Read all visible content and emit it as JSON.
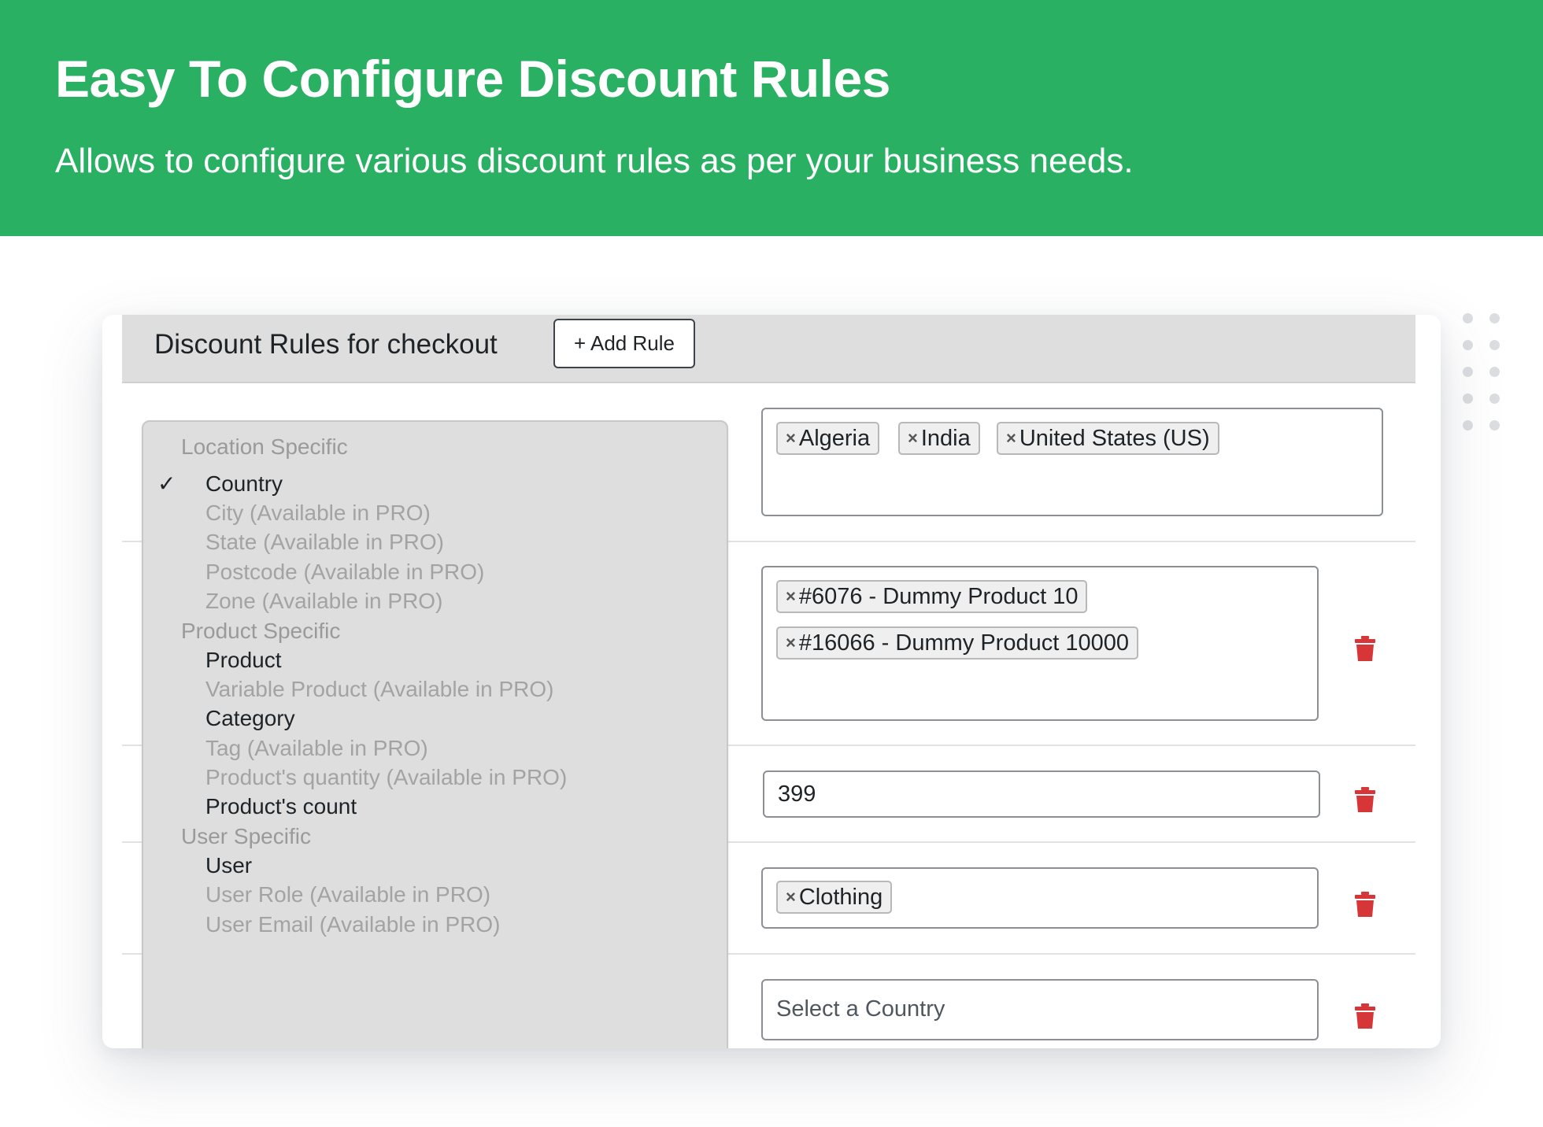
{
  "banner": {
    "title": "Easy To Configure Discount Rules",
    "subtitle": "Allows to configure various discount rules as per your business needs.",
    "color": "#2ab063"
  },
  "panel": {
    "title": "Discount Rules for checkout",
    "add_rule_label": "+ Add Rule"
  },
  "dropdown": {
    "groups": [
      {
        "label": "Location Specific",
        "items": [
          {
            "label": "Country",
            "checked": true,
            "disabled": false
          },
          {
            "label": "City (Available in PRO)",
            "disabled": true
          },
          {
            "label": "State (Available in PRO)",
            "disabled": true
          },
          {
            "label": "Postcode (Available in PRO)",
            "disabled": true
          },
          {
            "label": "Zone (Available in PRO)",
            "disabled": true
          }
        ]
      },
      {
        "label": "Product Specific",
        "items": [
          {
            "label": "Product",
            "disabled": false
          },
          {
            "label": "Variable Product (Available in PRO)",
            "disabled": true
          },
          {
            "label": "Category",
            "disabled": false
          },
          {
            "label": "Tag (Available in PRO)",
            "disabled": true
          },
          {
            "label": "Product's quantity (Available in PRO)",
            "disabled": true
          },
          {
            "label": "Product's count",
            "disabled": false
          }
        ]
      },
      {
        "label": "User Specific",
        "items": [
          {
            "label": "User",
            "disabled": false
          },
          {
            "label": "User Role (Available in PRO)",
            "disabled": true
          },
          {
            "label": "User Email (Available in PRO)",
            "disabled": true
          }
        ]
      }
    ],
    "check_glyph": "✓"
  },
  "rules": {
    "countries": {
      "tags": [
        "Algeria",
        "India",
        "United States (US)"
      ]
    },
    "products": {
      "tags": [
        "#6076 - Dummy Product 10",
        "#16066 - Dummy Product 10000"
      ]
    },
    "count": {
      "value": "399"
    },
    "category": {
      "tags": [
        "Clothing"
      ]
    },
    "country_select": {
      "placeholder": "Select a Country"
    }
  },
  "tag_remove_glyph": "×",
  "delete_icon_color": "#d63638"
}
